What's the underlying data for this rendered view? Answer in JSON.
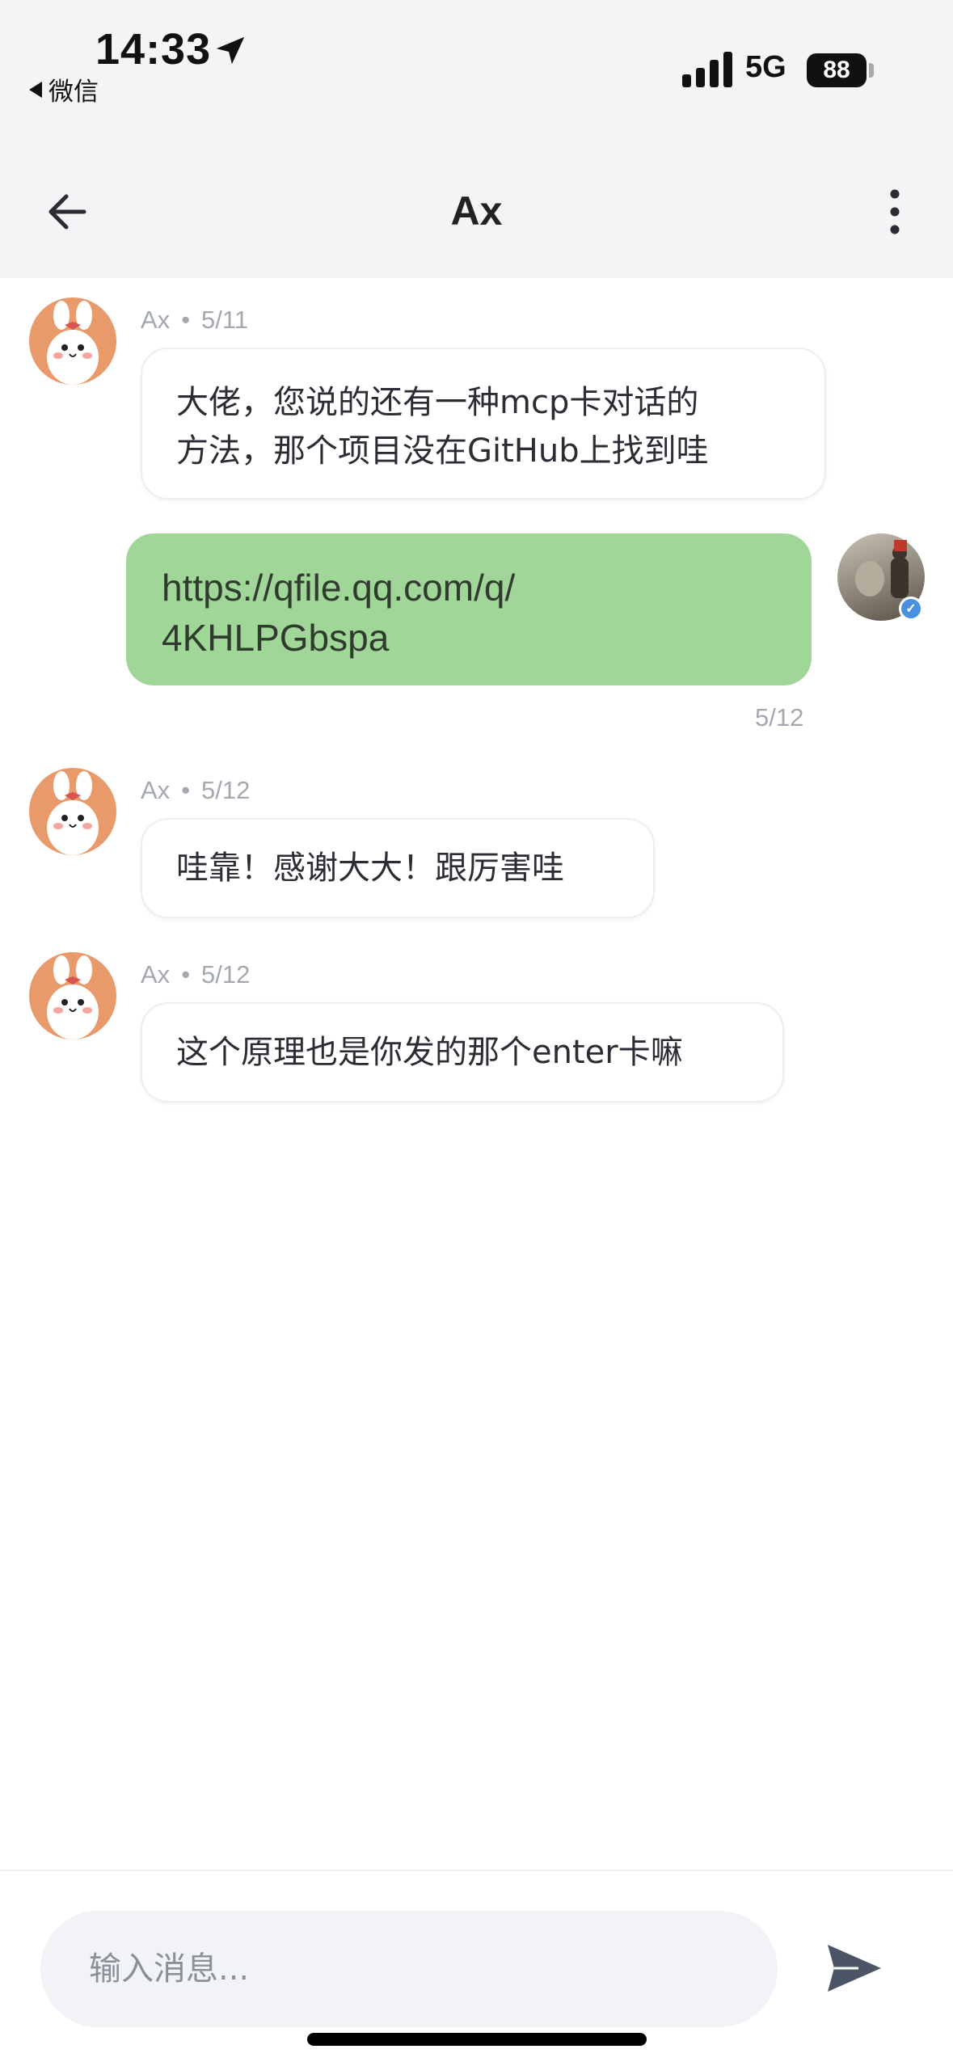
{
  "status_bar": {
    "time": "14:33",
    "back_app": "微信",
    "network": "5G",
    "battery": "88"
  },
  "header": {
    "title": "Ax"
  },
  "messages": [
    {
      "sender": "Ax",
      "date": "5/11",
      "text_lines": [
        "大佬，您说的还有一种mcp卡对话的",
        "方法，那个项目没在GitHub上找到哇"
      ]
    },
    {
      "sender": "me",
      "date": "5/12",
      "text_lines": [
        "https://qfile.qq.com/q/",
        "4KHLPGbspa"
      ]
    },
    {
      "sender": "Ax",
      "date": "5/12",
      "text_lines": [
        "哇靠！感谢大大！跟厉害哇"
      ]
    },
    {
      "sender": "Ax",
      "date": "5/12",
      "text_lines": [
        "这个原理也是你发的那个enter卡嘛"
      ]
    }
  ],
  "meta_separator": "•",
  "composer": {
    "placeholder": "输入消息..."
  },
  "colors": {
    "outgoing_bubble": "#a1d699",
    "header_bg": "#f3f4f6",
    "verified_badge": "#4a90e2"
  },
  "icons": {
    "back": "arrow-left-icon",
    "more": "more-vertical-icon",
    "send": "send-icon",
    "location": "location-arrow-icon",
    "verified": "verified-badge-icon"
  }
}
